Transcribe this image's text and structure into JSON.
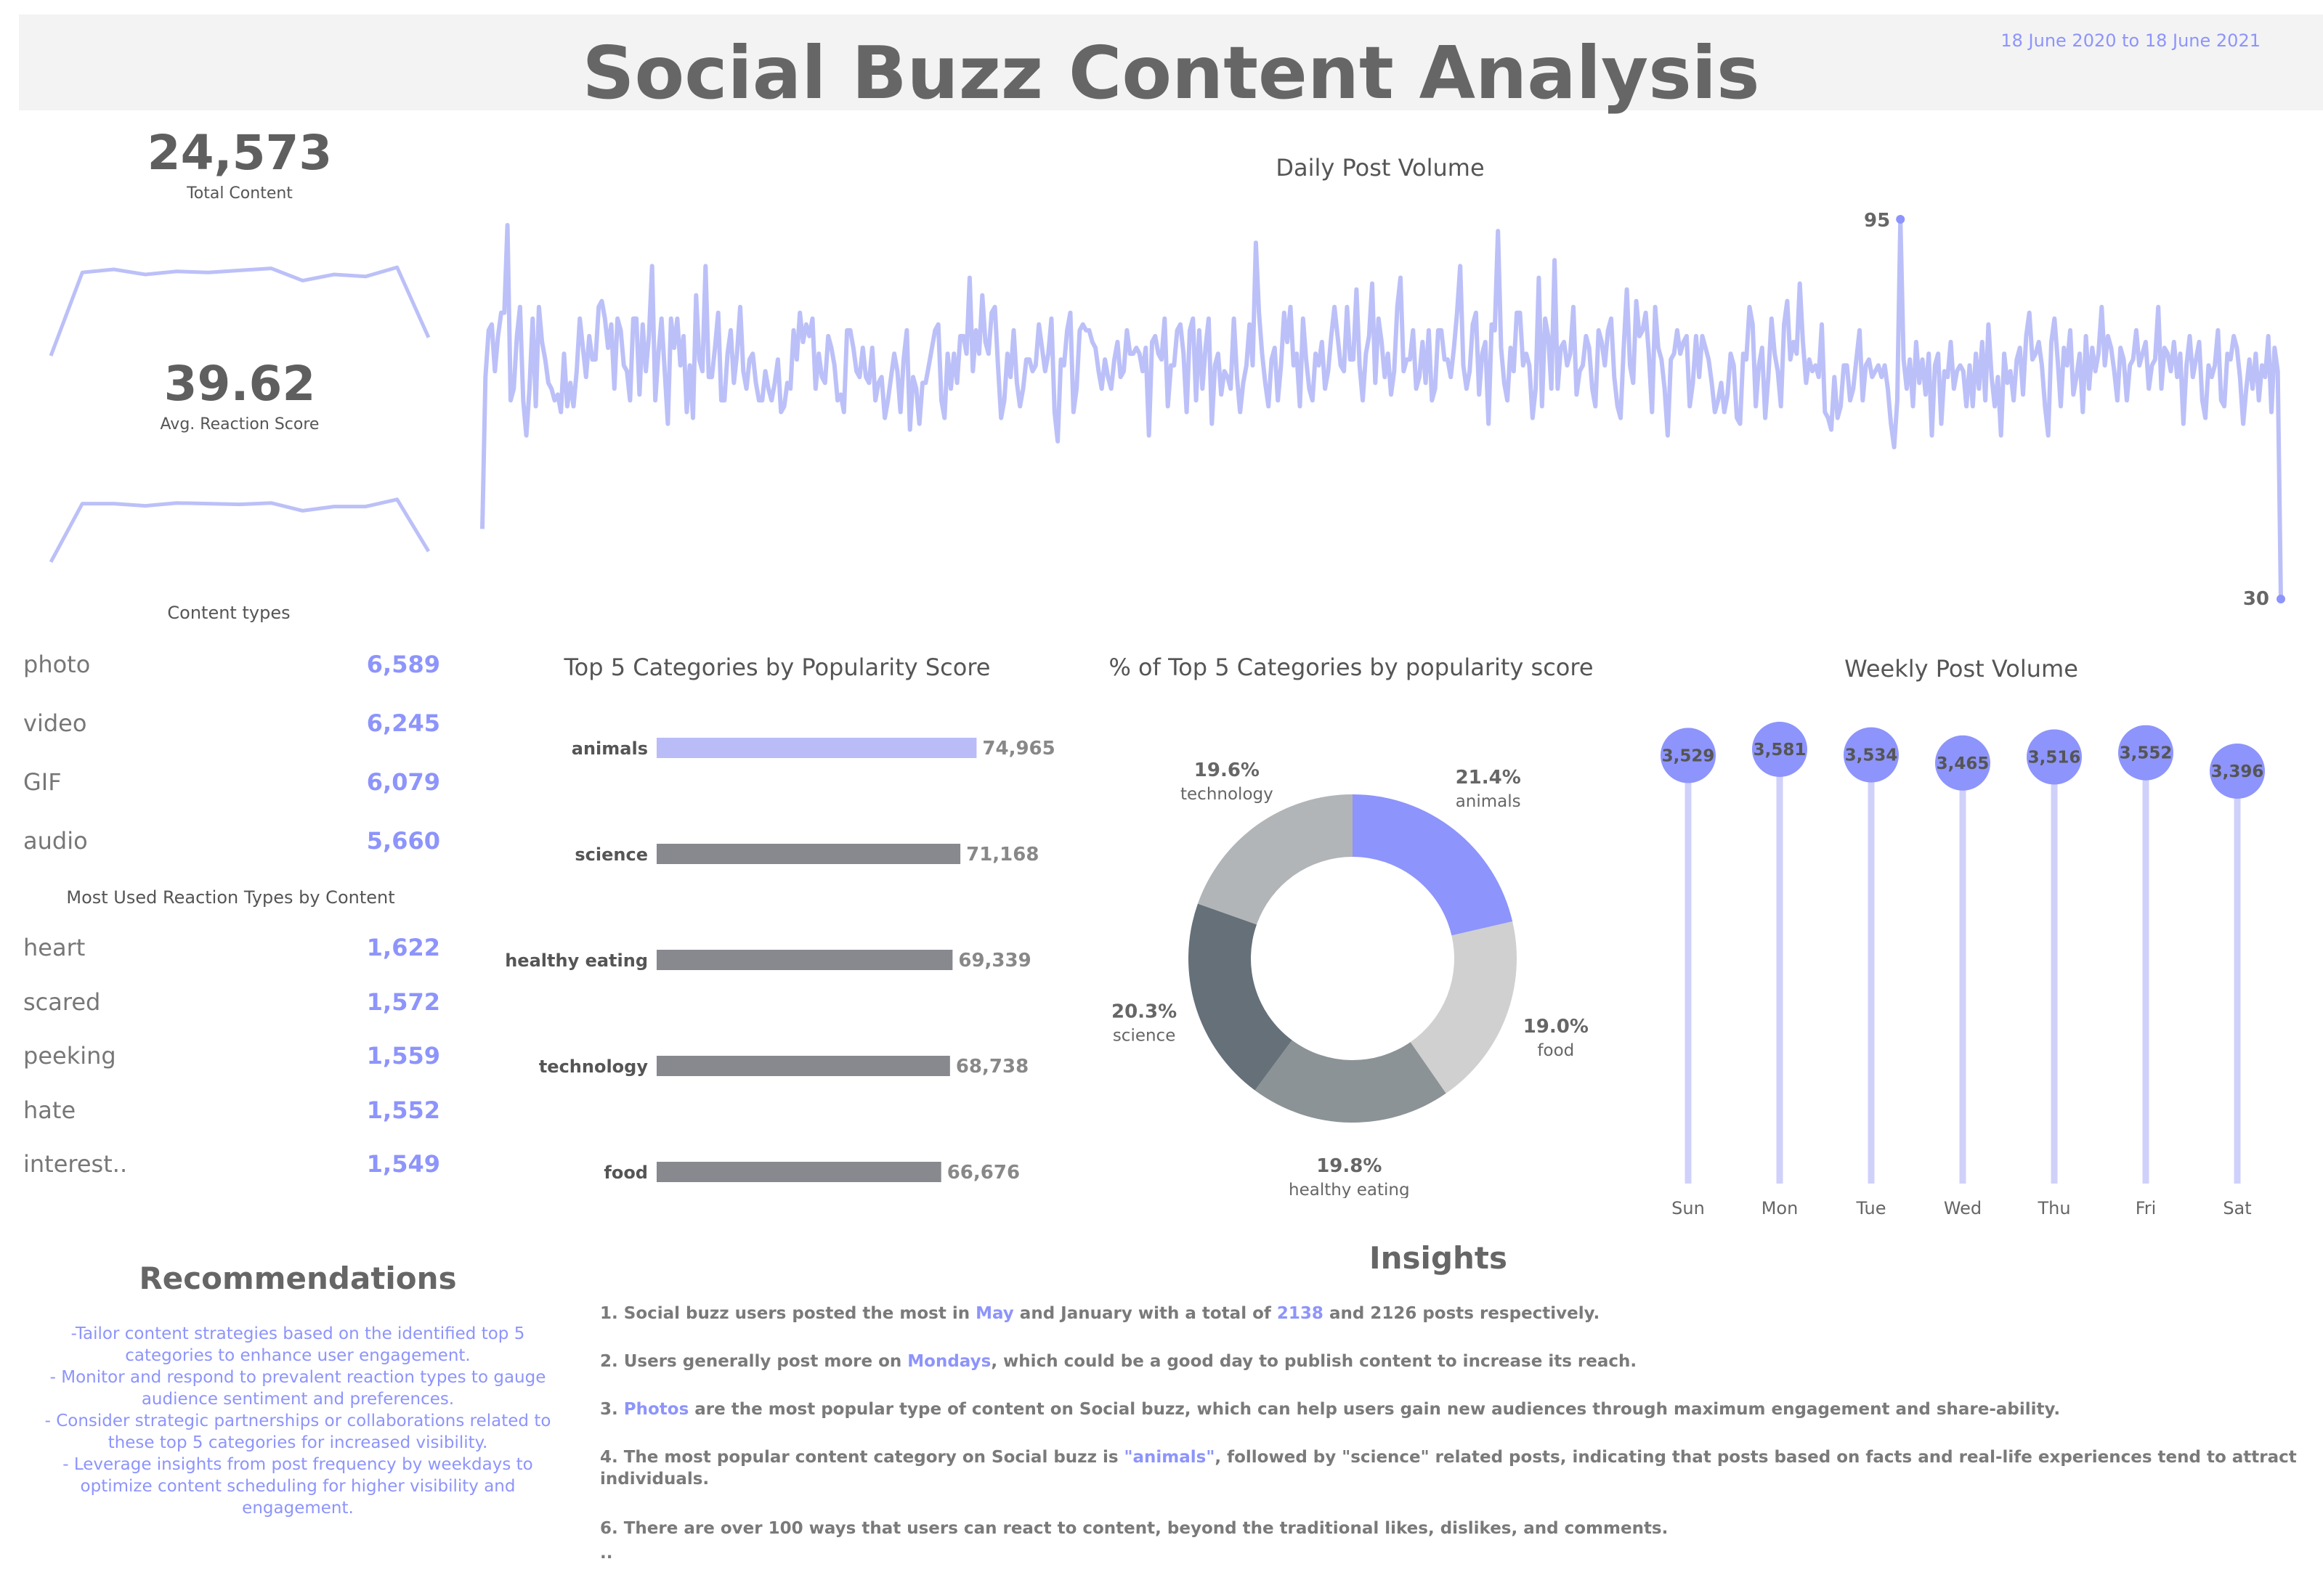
{
  "header": {
    "title": "Social Buzz Content Analysis",
    "date_range": "18 June 2020 to 18 June 2021"
  },
  "kpis": {
    "total_content": {
      "value": "24,573",
      "label": "Total Content"
    },
    "avg_reaction": {
      "value": "39.62",
      "label": "Avg. Reaction Score"
    }
  },
  "sparklines": {
    "total_content": [
      0.0,
      0.82,
      0.85,
      0.8,
      0.83,
      0.82,
      0.84,
      0.86,
      0.74,
      0.8,
      0.78,
      0.87,
      0.18
    ],
    "avg_reaction": [
      0.0,
      0.82,
      0.82,
      0.79,
      0.83,
      0.82,
      0.81,
      0.83,
      0.72,
      0.78,
      0.78,
      0.88,
      0.15
    ]
  },
  "content_types": {
    "title": "Content types",
    "items": [
      {
        "name": "photo",
        "value": "6,589"
      },
      {
        "name": "video",
        "value": "6,245"
      },
      {
        "name": "GIF",
        "value": "6,079"
      },
      {
        "name": "audio",
        "value": "5,660"
      }
    ]
  },
  "reaction_types": {
    "title": "Most Used Reaction Types by Content",
    "items": [
      {
        "name": "heart",
        "value": "1,622"
      },
      {
        "name": "scared",
        "value": "1,572"
      },
      {
        "name": "peeking",
        "value": "1,559"
      },
      {
        "name": "hate",
        "value": "1,552"
      },
      {
        "name": "interest..",
        "value": "1,549"
      }
    ]
  },
  "colors": {
    "accent": "#8d94fb",
    "line": "#bcc0f8",
    "bar_top": "#b9bcf7",
    "bar_other": "#88898f",
    "lollipop": "#cfd1fa",
    "donut": [
      "#8d94fb",
      "#d0d0d0",
      "#8c9396",
      "#657079",
      "#b2b5b7"
    ]
  },
  "chart_data": [
    {
      "type": "line",
      "title": "Daily Post Volume",
      "x_start": "18 June 2020",
      "x_end": "18 June 2021",
      "max_label": "95",
      "min_label": "30",
      "values": [
        42,
        68,
        76,
        77,
        69,
        75,
        79,
        79,
        94,
        64,
        66,
        75,
        80,
        64,
        58,
        66,
        78,
        63,
        80,
        74,
        71,
        67,
        66,
        64,
        65,
        62,
        72,
        63,
        67,
        63,
        69,
        78,
        73,
        68,
        75,
        71,
        71,
        80,
        81,
        78,
        73,
        77,
        66,
        78,
        76,
        70,
        69,
        64,
        78,
        78,
        65,
        77,
        69,
        75,
        87,
        64,
        72,
        78,
        69,
        60,
        78,
        73,
        78,
        70,
        75,
        62,
        70,
        61,
        82,
        71,
        69,
        87,
        68,
        68,
        73,
        79,
        64,
        64,
        72,
        76,
        67,
        72,
        80,
        69,
        66,
        71,
        72,
        67,
        64,
        64,
        69,
        66,
        64,
        67,
        71,
        62,
        63,
        67,
        66,
        76,
        71,
        79,
        74,
        77,
        75,
        78,
        66,
        72,
        68,
        67,
        75,
        73,
        70,
        64,
        65,
        62,
        76,
        76,
        73,
        69,
        68,
        73,
        68,
        67,
        73,
        64,
        67,
        68,
        61,
        64,
        68,
        72,
        69,
        62,
        71,
        76,
        59,
        68,
        66,
        60,
        67,
        67,
        70,
        73,
        76,
        77,
        64,
        61,
        72,
        66,
        72,
        67,
        75,
        75,
        72,
        85,
        69,
        76,
        72,
        82,
        74,
        72,
        79,
        80,
        70,
        61,
        64,
        72,
        68,
        76,
        67,
        63,
        66,
        71,
        71,
        69,
        70,
        77,
        73,
        69,
        72,
        78,
        62,
        57,
        71,
        70,
        76,
        79,
        62,
        66,
        76,
        77,
        76,
        76,
        74,
        73,
        69,
        66,
        71,
        68,
        66,
        71,
        74,
        68,
        69,
        76,
        72,
        72,
        73,
        72,
        69,
        73,
        58,
        74,
        75,
        72,
        71,
        78,
        63,
        70,
        70,
        76,
        77,
        72,
        62,
        76,
        78,
        64,
        76,
        66,
        73,
        78,
        60,
        70,
        72,
        65,
        69,
        68,
        66,
        78,
        68,
        62,
        67,
        70,
        77,
        70,
        91,
        79,
        72,
        67,
        63,
        71,
        73,
        64,
        70,
        79,
        74,
        80,
        70,
        72,
        63,
        78,
        71,
        66,
        64,
        72,
        70,
        74,
        66,
        69,
        75,
        80,
        75,
        70,
        69,
        80,
        71,
        71,
        83,
        70,
        64,
        72,
        75,
        84,
        67,
        78,
        74,
        68,
        72,
        65,
        69,
        80,
        85,
        69,
        71,
        71,
        76,
        66,
        68,
        74,
        67,
        76,
        64,
        66,
        76,
        76,
        71,
        71,
        68,
        73,
        79,
        87,
        70,
        66,
        69,
        77,
        79,
        65,
        72,
        74,
        60,
        77,
        76,
        93,
        73,
        67,
        64,
        73,
        69,
        79,
        79,
        70,
        72,
        70,
        61,
        66,
        85,
        63,
        78,
        75,
        66,
        88,
        66,
        73,
        74,
        70,
        72,
        80,
        65,
        69,
        70,
        75,
        73,
        66,
        63,
        76,
        74,
        70,
        76,
        78,
        68,
        63,
        61,
        73,
        83,
        70,
        67,
        81,
        75,
        76,
        79,
        72,
        62,
        80,
        73,
        71,
        66,
        58,
        71,
        72,
        76,
        72,
        74,
        75,
        63,
        67,
        75,
        68,
        75,
        73,
        71,
        67,
        62,
        64,
        67,
        62,
        65,
        72,
        70,
        61,
        60,
        72,
        71,
        80,
        77,
        63,
        70,
        73,
        61,
        68,
        78,
        72,
        69,
        63,
        77,
        81,
        71,
        74,
        72,
        84,
        74,
        67,
        71,
        69,
        70,
        68,
        77,
        62,
        61,
        59,
        68,
        61,
        63,
        70,
        70,
        64,
        66,
        71,
        76,
        64,
        70,
        71,
        68,
        69,
        70,
        68,
        70,
        66,
        60,
        56,
        64,
        95,
        71,
        66,
        71,
        63,
        74,
        67,
        71,
        65,
        72,
        58,
        70,
        72,
        60,
        69,
        68,
        74,
        66,
        69,
        70,
        69,
        63,
        70,
        63,
        72,
        66,
        74,
        64,
        77,
        68,
        63,
        68,
        58,
        72,
        67,
        69,
        64,
        71,
        73,
        65,
        75,
        79,
        71,
        72,
        74,
        70,
        63,
        58,
        74,
        78,
        71,
        63,
        73,
        70,
        76,
        65,
        68,
        72,
        62,
        75,
        66,
        73,
        69,
        72,
        80,
        70,
        75,
        73,
        69,
        64,
        73,
        71,
        64,
        70,
        71,
        76,
        70,
        72,
        74,
        66,
        70,
        71,
        80,
        66,
        73,
        72,
        69,
        74,
        68,
        72,
        60,
        70,
        75,
        68,
        71,
        74,
        64,
        61,
        70,
        68,
        70,
        76,
        64,
        63,
        72,
        71,
        75,
        73,
        68,
        60,
        66,
        71,
        66,
        72,
        64,
        70,
        68,
        75,
        62,
        73,
        69,
        30
      ]
    },
    {
      "type": "bar",
      "title": "Top 5 Categories by Popularity Score",
      "categories": [
        "animals",
        "science",
        "healthy eating",
        "technology",
        "food"
      ],
      "values": [
        74965,
        71168,
        69339,
        68738,
        66676
      ],
      "value_labels": [
        "74,965",
        "71,168",
        "69,339",
        "68,738",
        "66,676"
      ]
    },
    {
      "type": "pie",
      "title": "% of Top 5 Categories by popularity score",
      "labels": [
        "animals",
        "food",
        "healthy eating",
        "science",
        "technology"
      ],
      "values": [
        21.4,
        19.0,
        19.8,
        20.3,
        19.6
      ],
      "value_labels": [
        "21.4%",
        "19.0%",
        "19.8%",
        "20.3%",
        "19.6%"
      ]
    },
    {
      "type": "bar",
      "title": "Weekly Post Volume",
      "categories": [
        "Sun",
        "Mon",
        "Tue",
        "Wed",
        "Thu",
        "Fri",
        "Sat"
      ],
      "values": [
        3529,
        3581,
        3534,
        3465,
        3516,
        3552,
        3396
      ],
      "value_labels": [
        "3,529",
        "3,581",
        "3,534",
        "3,465",
        "3,516",
        "3,552",
        "3,396"
      ]
    }
  ],
  "recommendations": {
    "title": "Recommendations",
    "text": "-Tailor content strategies based on the identified top 5 categories to enhance user engagement.\n - Monitor and respond to prevalent reaction types to gauge audience sentiment and preferences.\n - Consider strategic partnerships or collaborations related to these top 5 categories for increased visibility.\n - Leverage insights from post frequency by weekdays to optimize content scheduling for higher visibility and engagement."
  },
  "insights": {
    "title": "Insights",
    "i1": {
      "a": "1. Social buzz users posted the most in ",
      "b": "May",
      "c": " and January with a total of ",
      "d": "2138",
      "e": " and 2126 posts respectively."
    },
    "i2": {
      "a": "2. Users generally post more on ",
      "b": "Mondays",
      "c": ", which could be a good day to publish content to increase its reach."
    },
    "i3": {
      "a": "3. ",
      "b": "Photos",
      "c": " are the most popular type of content on Social buzz, which can help users gain new audiences through maximum engagement and share-ability."
    },
    "i4": {
      "a": "4. The most popular content category on Social buzz is ",
      "b": "\"animals\"",
      "c": ", followed by \"science\" related posts, indicating that posts based on facts and real-life experiences tend to attract individuals."
    },
    "i6": "6. There are over 100 ways that users can react to content, beyond the traditional likes, dislikes, and comments.",
    "more": ".."
  }
}
